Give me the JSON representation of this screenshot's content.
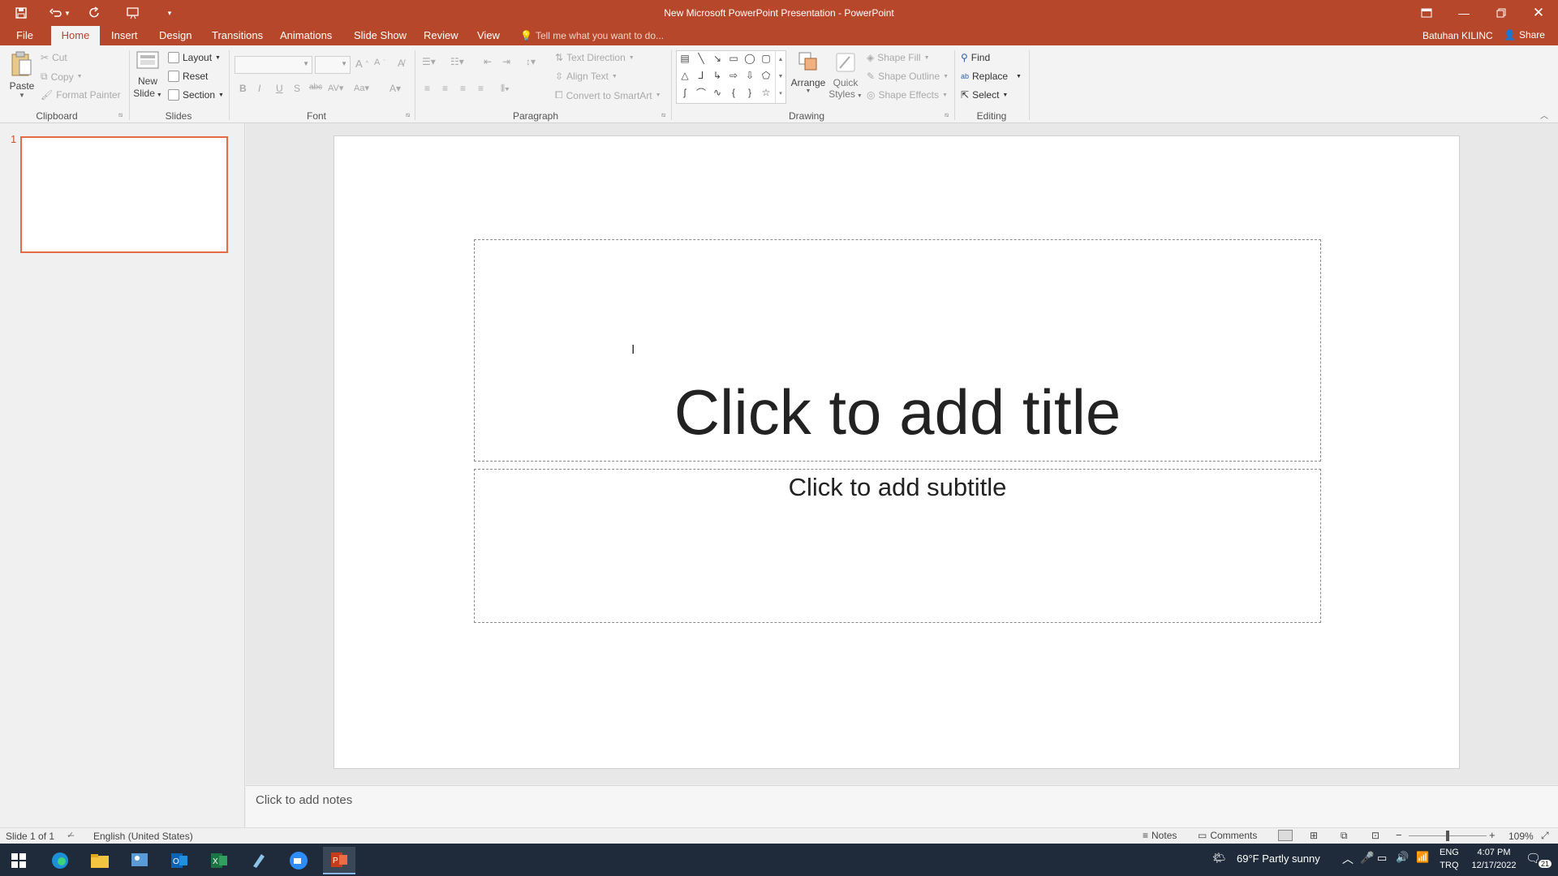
{
  "window": {
    "title": "New Microsoft PowerPoint Presentation - PowerPoint",
    "user": "Batuhan KILINC",
    "share": "Share",
    "colors": {
      "accent": "#b7472a",
      "selection": "#e56b47"
    }
  },
  "tabs": [
    {
      "label": "File"
    },
    {
      "label": "Home"
    },
    {
      "label": "Insert"
    },
    {
      "label": "Design"
    },
    {
      "label": "Transitions"
    },
    {
      "label": "Animations"
    },
    {
      "label": "Slide Show"
    },
    {
      "label": "Review"
    },
    {
      "label": "View"
    }
  ],
  "tell_me": "Tell me what you want to do...",
  "ribbon": {
    "clipboard": {
      "label": "Clipboard",
      "paste": "Paste",
      "cut": "Cut",
      "copy": "Copy",
      "format_painter": "Format Painter"
    },
    "slides": {
      "label": "Slides",
      "new_slide_1": "New",
      "new_slide_2": "Slide",
      "layout": "Layout",
      "reset": "Reset",
      "section": "Section"
    },
    "font": {
      "label": "Font"
    },
    "paragraph": {
      "label": "Paragraph",
      "text_direction": "Text Direction",
      "align_text": "Align Text",
      "convert_smartart": "Convert to SmartArt"
    },
    "drawing": {
      "label": "Drawing",
      "arrange": "Arrange",
      "quick_styles_1": "Quick",
      "quick_styles_2": "Styles",
      "shape_fill": "Shape Fill",
      "shape_outline": "Shape Outline",
      "shape_effects": "Shape Effects"
    },
    "editing": {
      "label": "Editing",
      "find": "Find",
      "replace": "Replace",
      "select": "Select"
    }
  },
  "thumbnail": {
    "number": "1"
  },
  "slide": {
    "title_placeholder": "Click to add title",
    "subtitle_placeholder": "Click to add subtitle"
  },
  "notes": {
    "placeholder": "Click to add notes"
  },
  "status": {
    "slide_info": "Slide 1 of 1",
    "language": "English (United States)",
    "notes": "Notes",
    "comments": "Comments",
    "zoom": "109%"
  },
  "taskbar": {
    "weather": "69°F  Partly sunny",
    "lang_1": "ENG",
    "lang_2": "TRQ",
    "time": "4:07 PM",
    "date": "12/17/2022",
    "notif": "21"
  }
}
